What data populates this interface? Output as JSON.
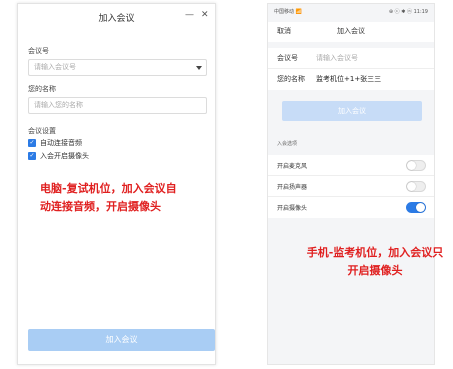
{
  "desktop": {
    "title": "加入会议",
    "minimize_symbol": "—",
    "close_symbol": "✕",
    "meeting_id": {
      "label": "会议号",
      "placeholder": "请输入会议号"
    },
    "name": {
      "label": "您的名称",
      "placeholder": "请输入您的名称"
    },
    "settings_label": "会议设置",
    "options": [
      {
        "label": "自动连接音频",
        "checked": true
      },
      {
        "label": "入会开启摄像头",
        "checked": true
      }
    ],
    "join_label": "加入会议",
    "annotation_lines": [
      "电脑-复试机位，加入会议自",
      "动连接音频，开启摄像头"
    ]
  },
  "mobile": {
    "status_left": "中国移动 📶 ",
    "status_right": "⊕ ⓒ ✱ ⓝ 11:19",
    "cancel_label": "取消",
    "title": "加入会议",
    "meeting_id": {
      "label": "会议号",
      "placeholder": "请输入会议号"
    },
    "name": {
      "label": "您的名称",
      "value": "监考机位+1+张三三"
    },
    "join_label": "加入会议",
    "section_label": "入会选项",
    "toggles": [
      {
        "label": "开启麦克风",
        "on": false
      },
      {
        "label": "开启扬声器",
        "on": false
      },
      {
        "label": "开启摄像头",
        "on": true
      }
    ],
    "annotation_lines": [
      "手机-监考机位，加入会议只",
      "开启摄像头"
    ]
  },
  "colors": {
    "accent": "#2c7be5",
    "annotation": "#e02020",
    "join_disabled": "#a9cdf4"
  },
  "icons": [
    "minimize-icon",
    "close-icon",
    "chevron-down-icon",
    "checkbox-checked-icon",
    "toggle-switch-icon"
  ]
}
